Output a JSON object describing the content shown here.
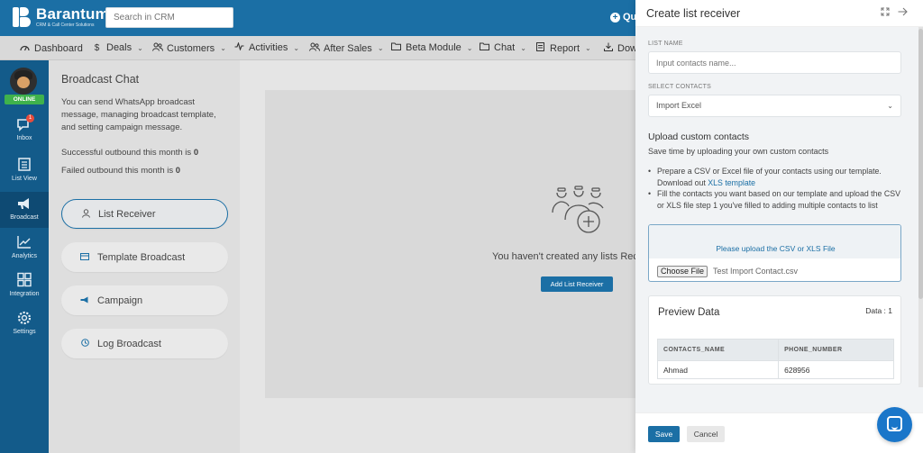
{
  "app": {
    "brand_name": "Barantum",
    "brand_tagline": "CRM & Call Center Solutions",
    "search_placeholder": "Search in CRM",
    "quick_label": "Qui"
  },
  "nav": [
    {
      "label": "Dashboard",
      "icon": "dashboard-icon"
    },
    {
      "label": "Deals",
      "icon": "dollar-icon"
    },
    {
      "label": "Customers",
      "icon": "users-icon"
    },
    {
      "label": "Activities",
      "icon": "activity-icon"
    },
    {
      "label": "After Sales",
      "icon": "users-icon"
    },
    {
      "label": "Beta Module",
      "icon": "folder-icon"
    },
    {
      "label": "Chat",
      "icon": "folder-icon"
    },
    {
      "label": "Report",
      "icon": "report-icon"
    },
    {
      "label": "Dow",
      "icon": "download-icon"
    }
  ],
  "sidebar": {
    "status": "ONLINE",
    "inbox_badge": "1",
    "items": [
      {
        "label": "Inbox",
        "icon": "inbox-icon"
      },
      {
        "label": "List View",
        "icon": "list-view-icon"
      },
      {
        "label": "Broadcast",
        "icon": "broadcast-icon",
        "active": true
      },
      {
        "label": "Analytics",
        "icon": "analytics-icon"
      },
      {
        "label": "Integration",
        "icon": "integration-icon"
      },
      {
        "label": "Settings",
        "icon": "settings-icon"
      }
    ]
  },
  "broadcast": {
    "title": "Broadcast Chat",
    "description": "You can send WhatsApp broadcast message, managing broadcast template, and setting campaign message.",
    "success_label": "Successful outbound this month is ",
    "success_value": "0",
    "failed_label": "Failed outbound this month is ",
    "failed_value": "0",
    "menu": [
      {
        "label": "List Receiver",
        "icon": "user-icon",
        "active": true
      },
      {
        "label": "Template Broadcast",
        "icon": "template-icon"
      },
      {
        "label": "Campaign",
        "icon": "megaphone-icon"
      },
      {
        "label": "Log Broadcast",
        "icon": "clock-icon"
      }
    ]
  },
  "empty": {
    "message": "You haven't created any lists Receiv",
    "button": "Add List Receiver"
  },
  "modal": {
    "title": "Create list receiver",
    "list_name_label": "LIST NAME",
    "list_name_placeholder": "Input contacts name...",
    "select_contacts_label": "SELECT CONTACTS",
    "select_contacts_value": "Import Excel",
    "upload_title": "Upload custom contacts",
    "upload_subtitle": "Save time by uploading your own custom contacts",
    "bullet1_text": "Prepare a CSV or Excel file of your contacts using our template. Download out ",
    "bullet1_link": "XLS template",
    "bullet2_text": "Fill the contacts you want based on our template and upload the CSV or XLS file step 1 you've filled to adding multiple contacts to list",
    "upload_hint": "Please upload the CSV or XLS File",
    "choose_file": "Choose File",
    "file_name": "Test Import Contact.csv",
    "preview_title": "Preview Data",
    "data_count": "Data : 1",
    "table_headers": [
      "CONTACTS_NAME",
      "PHONE_NUMBER"
    ],
    "table_rows": [
      [
        "Ahmad",
        "628956"
      ]
    ],
    "save": "Save",
    "cancel": "Cancel"
  },
  "colors": {
    "primary": "#1b6fa5",
    "sidebar": "#135b8a",
    "online": "#3fb24c",
    "badge": "#e74c3c"
  }
}
